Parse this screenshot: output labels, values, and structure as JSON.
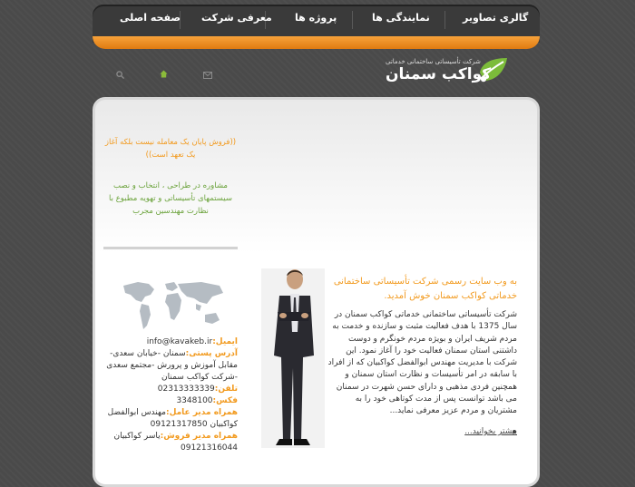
{
  "nav": {
    "items": [
      {
        "label": "گالری تصاویر"
      },
      {
        "label": "نمایندگی ها"
      },
      {
        "label": "پروژه ها"
      },
      {
        "label": "معرفی شرکت"
      },
      {
        "label": "صفحه اصلی"
      }
    ]
  },
  "header": {
    "logo_subtitle": "شرکت تأسیساتی ساختمانی خدماتی",
    "logo_title": "کواکب سمنان"
  },
  "sidebar": {
    "quote": "((فروش پایان یک معامله نیست بلکه آغاز یک تعهد است))",
    "consult": "مشاوره در طراحی ، انتخاب و نصب سیستمهای تأسیساتی و تهویه مطبوع با نظارت مهندسین مجرب",
    "contact": {
      "email_label": "ایمیل:",
      "email_value": "info@kavakeb.ir",
      "address_label": "آدرس پستی:",
      "address_value": "سمنان -خیابان سعدی-مقابل آموزش و پرورش -مجتمع سعدی -شرکت کواکب سمنان",
      "phone_label": "تلفن:",
      "phone_value": "02313333339",
      "fax_label": "فکس:",
      "fax_value": "3348100",
      "ceo_label": "همراه مدیر عامل:",
      "ceo_value": "مهندس ابوالفضل کواکبیان 09121317850",
      "sales_label": "همراه مدیر فروش:",
      "sales_value": "یاسر کواکبیان 09121316044"
    }
  },
  "main": {
    "welcome": "به وب سایت رسمی شرکت تأسیساتی ساختمانی خدماتی کواکب سمنان خوش آمدید.",
    "body": "شرکت تأسیساتی ساختمانی خدماتی کواکب سمنان در سال 1375 با هدف فعالیت مثبت و سازنده و خدمت به مردم شریف ایران و بویژه مردم خونگرم و دوست داشتنی استان سمنان فعالیت خود را آغاز نمود. این شرکت با مدیریت مهندس ابوالفضل کواکبیان که از افراد با سابقه در امر تأسیسات و نظارت استان سمنان و همچنین فردی مذهبی و دارای حسن شهرت در سمنان می باشد توانست پس از مدت کوتاهی خود را به مشتریان و مردم عزیز معرفی نماید...",
    "more_link": "بیشتر بخوانید..."
  },
  "icons": [
    "search-icon",
    "home-icon",
    "mail-icon",
    "leaf-logo-icon",
    "world-map-icon"
  ],
  "colors": {
    "accent": "#f29a1e",
    "green": "#6aa23a",
    "nav_dark": "#3a3a3a"
  }
}
